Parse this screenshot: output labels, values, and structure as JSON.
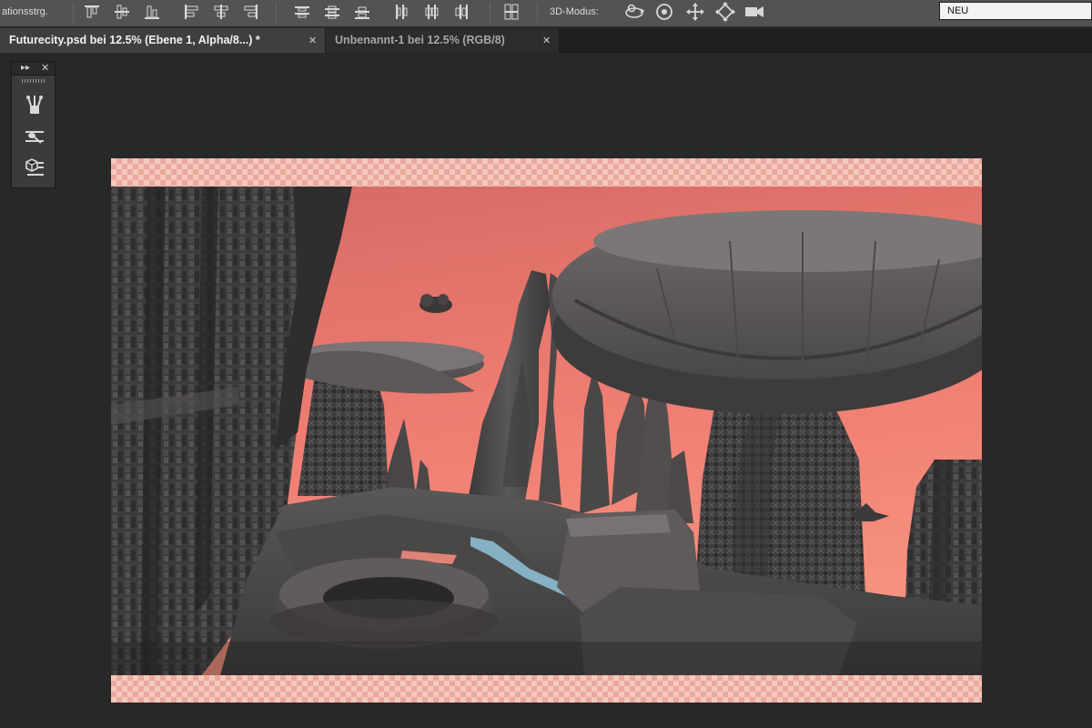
{
  "options_bar": {
    "partial_label": "ationsstrg.",
    "mode_label": "3D-Modus:",
    "preset_value": "NEU",
    "align_icons": [
      "align-top-edges-icon",
      "align-vertical-centers-icon",
      "align-bottom-edges-icon",
      "align-left-edges-icon",
      "align-horizontal-centers-icon",
      "align-right-edges-icon"
    ],
    "distribute_icons": [
      "distribute-top-icon",
      "distribute-vertical-centers-icon",
      "distribute-bottom-icon",
      "distribute-left-icon",
      "distribute-horizontal-centers-icon",
      "distribute-right-icon"
    ],
    "mode_icons": [
      "rotate-3d-icon",
      "roll-3d-icon",
      "pan-3d-icon",
      "slide-3d-icon",
      "scale-3d-icon"
    ]
  },
  "tabs": [
    {
      "label": "Futurecity.psd bei 12.5% (Ebene 1, Alpha/8...) *",
      "active": true
    },
    {
      "label": "Unbenannt-1 bei 12.5% (RGB/8)",
      "active": false
    }
  ],
  "tool_panel": {
    "tools": [
      "brush-presets-icon",
      "tool-presets-icon",
      "3d-panel-icon"
    ]
  },
  "colors": {
    "sky_top": "#d46a64",
    "sky_bottom": "#f2867a",
    "app_background": "#282828",
    "transparency_light": "#f4c8bd",
    "transparency_dark": "#e9a99c"
  }
}
